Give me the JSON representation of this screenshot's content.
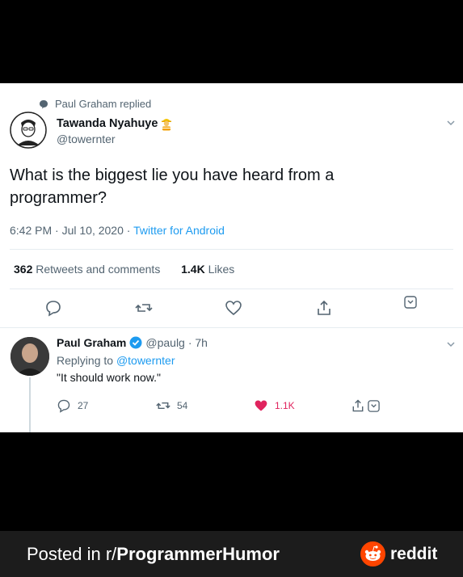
{
  "colors": {
    "accent": "#1d9bf0",
    "like": "#e0245e",
    "reddit": "#ff4500"
  },
  "parent": {
    "replied_label": "Paul Graham replied",
    "author_name": "Tawanda Nyahuye",
    "author_handle": "@towernter",
    "text": "What is the biggest lie you have heard from a programmer?",
    "time": "6:42 PM · Jul 10, 2020 ·",
    "source": "Twitter for Android",
    "retweets_count": "362",
    "retweets_label": "Retweets and comments",
    "likes_count": "1.4K",
    "likes_label": "Likes"
  },
  "reply": {
    "author_name": "Paul Graham",
    "author_handle": "@paulg",
    "time": "· 7h",
    "replying_prefix": "Replying to",
    "replying_to": "@towernter",
    "text": "\"It should work now.\"",
    "replies": "27",
    "retweets": "54",
    "likes": "1.1K"
  },
  "footer": {
    "posted_prefix": "Posted in r/",
    "subreddit": "ProgrammerHumor",
    "brand": "reddit"
  }
}
